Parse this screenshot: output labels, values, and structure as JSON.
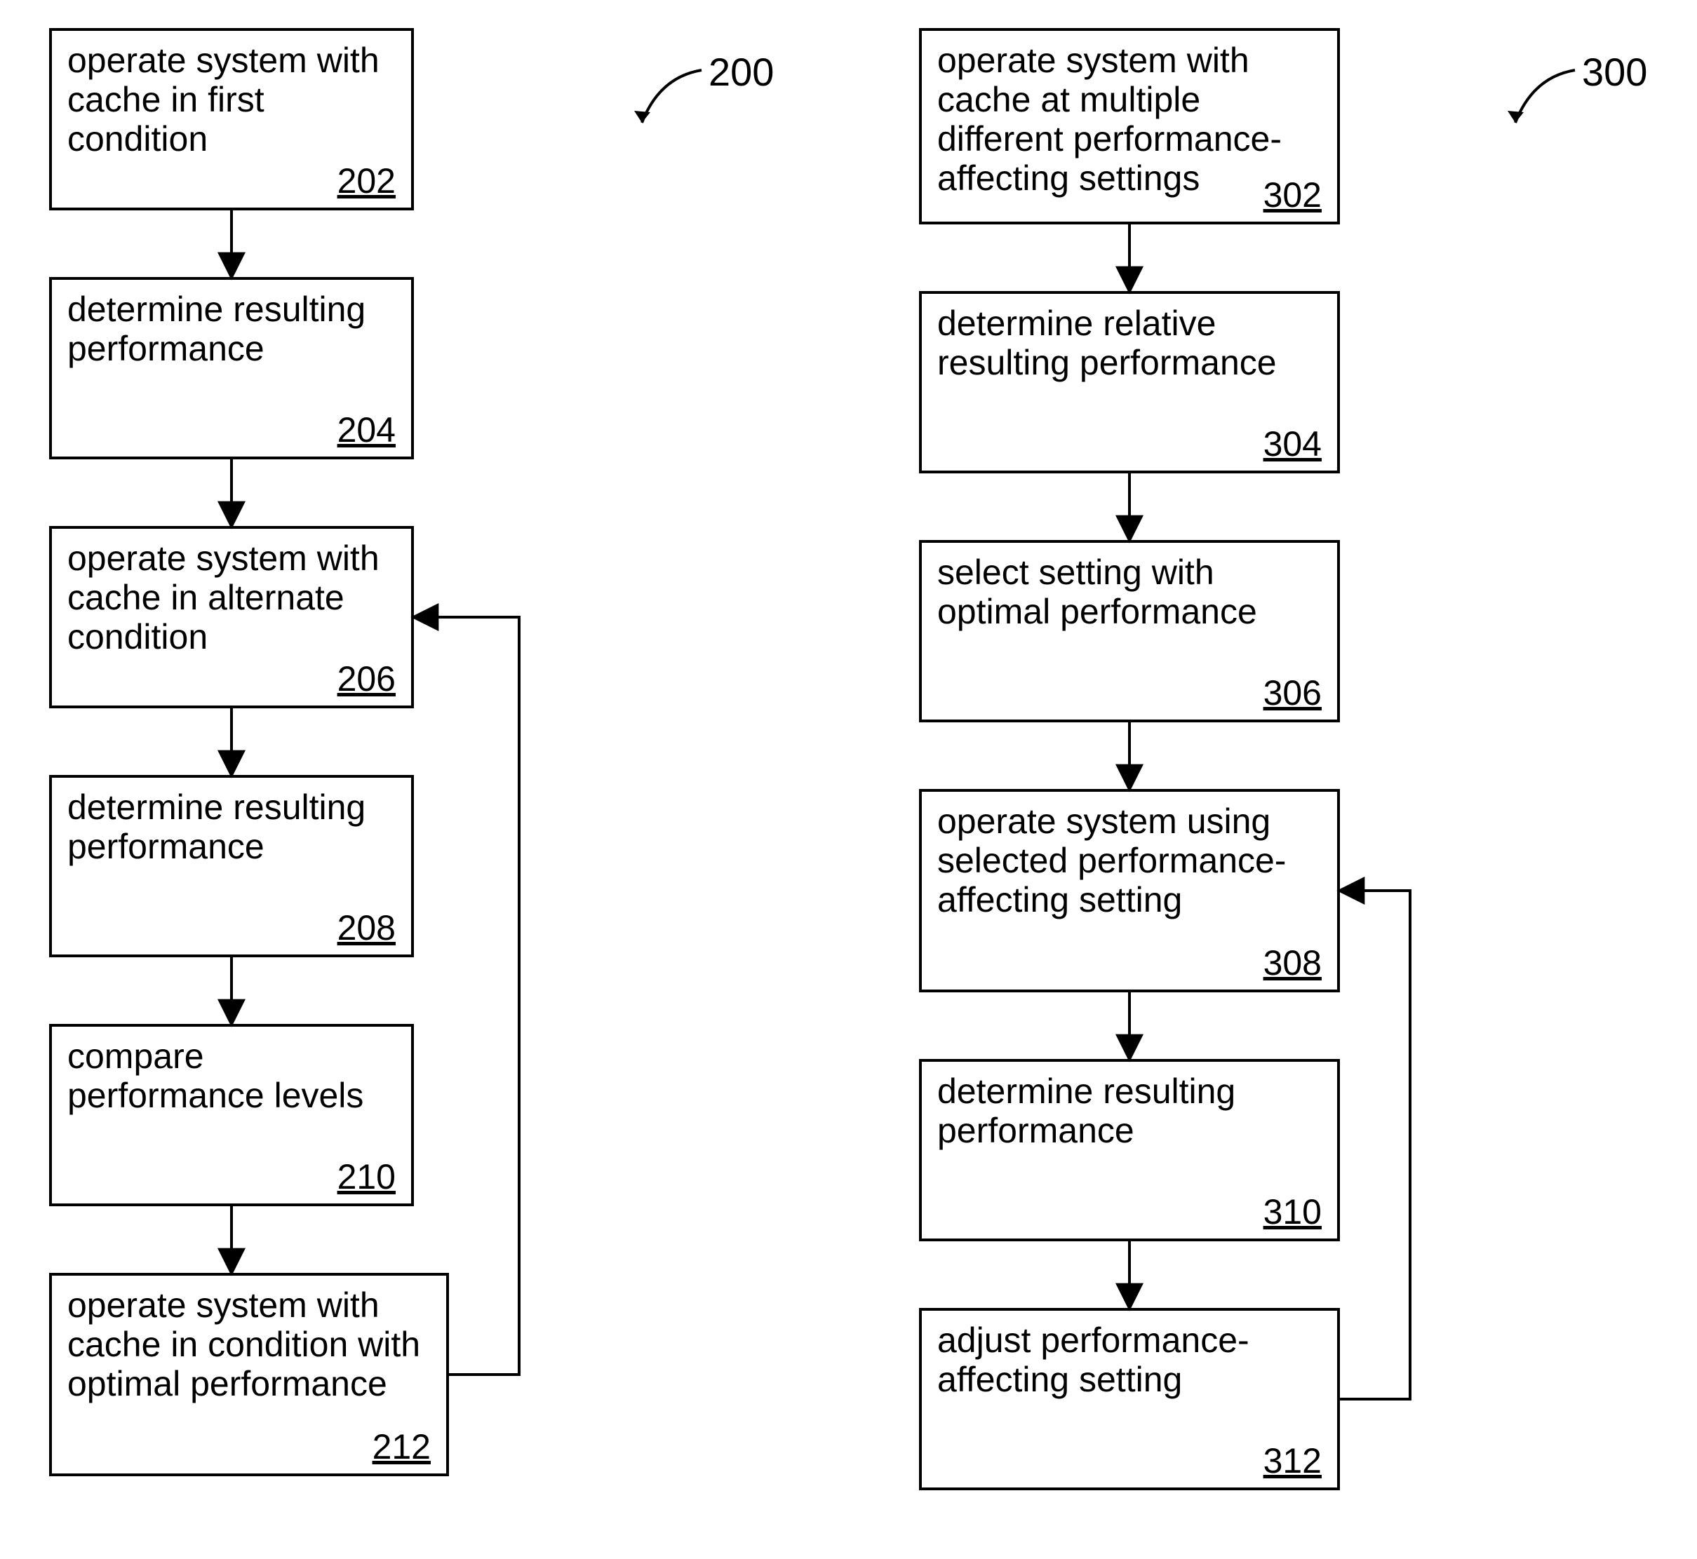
{
  "figures": {
    "left": {
      "label": "200",
      "boxes": [
        {
          "id": "202",
          "text": "operate system with cache in first condition",
          "ref": "202"
        },
        {
          "id": "204",
          "text": "determine resulting performance",
          "ref": "204"
        },
        {
          "id": "206",
          "text": "operate system with cache in alternate condition",
          "ref": "206"
        },
        {
          "id": "208",
          "text": "determine resulting performance",
          "ref": "208"
        },
        {
          "id": "210",
          "text": "compare performance levels",
          "ref": "210"
        },
        {
          "id": "212",
          "text": "operate system with cache in condition with optimal performance",
          "ref": "212"
        }
      ]
    },
    "right": {
      "label": "300",
      "boxes": [
        {
          "id": "302",
          "text": "operate system with cache at multiple different performance-affecting settings",
          "ref": "302"
        },
        {
          "id": "304",
          "text": "determine relative resulting performance",
          "ref": "304"
        },
        {
          "id": "306",
          "text": "select setting with optimal performance",
          "ref": "306"
        },
        {
          "id": "308",
          "text": "operate system using selected performance-affecting setting",
          "ref": "308"
        },
        {
          "id": "310",
          "text": "determine resulting performance",
          "ref": "310"
        },
        {
          "id": "312",
          "text": "adjust performance-affecting setting",
          "ref": "312"
        }
      ]
    }
  }
}
